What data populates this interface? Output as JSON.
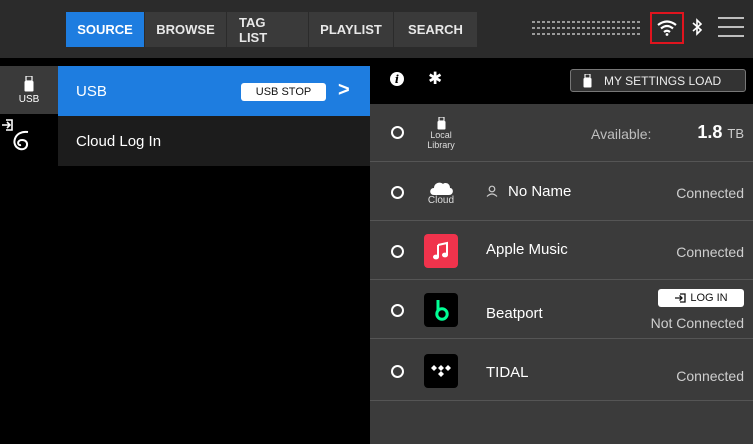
{
  "tabs": [
    {
      "label": "SOURCE",
      "active": true
    },
    {
      "label": "BROWSE",
      "active": false
    },
    {
      "label": "TAG LIST",
      "active": false
    },
    {
      "label": "PLAYLIST",
      "active": false
    },
    {
      "label": "SEARCH",
      "active": false
    }
  ],
  "status_icons": [
    "wifi-icon",
    "bluetooth-icon",
    "menu-icon"
  ],
  "highlight_color": "#e0141e",
  "accent_color": "#1e7de0",
  "strip": {
    "usb_label": "USB"
  },
  "sources": {
    "usb": {
      "label": "USB",
      "stop_label": "USB STOP",
      "arrow": ">"
    },
    "cloud": {
      "label": "Cloud Log In"
    }
  },
  "right_header": {
    "settings_button": "MY SETTINGS LOAD"
  },
  "services": [
    {
      "icon_label": "Local\nLibrary",
      "icon_line1": "Local",
      "icon_line2": "Library",
      "available_label": "Available:",
      "available_value": "1.8",
      "available_unit": "TB"
    },
    {
      "icon_label": "Cloud",
      "name": "No Name",
      "status": "Connected"
    },
    {
      "name": "Apple Music",
      "status": "Connected"
    },
    {
      "name": "Beatport",
      "login_label": "LOG IN",
      "status": "Not Connected"
    },
    {
      "name": "TIDAL",
      "status": "Connected"
    }
  ]
}
